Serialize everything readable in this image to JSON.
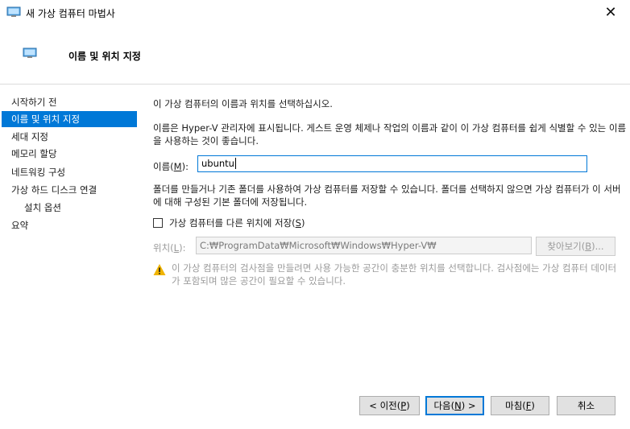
{
  "window": {
    "title": "새 가상 컴퓨터 마법사",
    "icon": "computer-monitor-icon",
    "close_glyph": "✕"
  },
  "header": {
    "title": "이름 및 위치 지정",
    "icon": "computer-monitor-icon"
  },
  "nav": {
    "items": [
      {
        "label": "시작하기 전",
        "selected": false
      },
      {
        "label": "이름 및 위치 지정",
        "selected": true
      },
      {
        "label": "세대 지정",
        "selected": false
      },
      {
        "label": "메모리 할당",
        "selected": false
      },
      {
        "label": "네트워킹 구성",
        "selected": false
      },
      {
        "label": "가상 하드 디스크 연결",
        "selected": false
      },
      {
        "label": "설치 옵션",
        "selected": false,
        "sub": true
      },
      {
        "label": "요약",
        "selected": false
      }
    ]
  },
  "content": {
    "intro": "이 가상 컴퓨터의 이름과 위치를 선택하십시오.",
    "description": "이름은 Hyper-V 관리자에 표시됩니다. 게스트 운영 체제나 작업의 이름과 같이 이 가상 컴퓨터를 쉽게 식별할 수 있는 이름을 사용하는 것이 좋습니다.",
    "name_label_pre": "이름(",
    "name_label_key": "M",
    "name_label_post": "):",
    "name_value": "ubuntu",
    "folder_note": "폴더를 만들거나 기존 폴더를 사용하여 가상 컴퓨터를 저장할 수 있습니다. 폴더를 선택하지 않으면 가상 컴퓨터가 이 서버에 대해 구성된 기본 폴더에 저장됩니다.",
    "checkbox_label_pre": "가상 컴퓨터를 다른 위치에 저장(",
    "checkbox_label_key": "S",
    "checkbox_label_post": ")",
    "checkbox_checked": false,
    "location_label_pre": "위치(",
    "location_label_key": "L",
    "location_label_post": "):",
    "location_value": "C:₩ProgramData₩Microsoft₩Windows₩Hyper-V₩",
    "browse_label_pre": "찾아보기(",
    "browse_label_key": "B",
    "browse_label_post": ")...",
    "warning": "이 가상 컴퓨터의 검사점을 만들려면 사용 가능한 공간이 충분한 위치를 선택합니다. 검사점에는 가상 컴퓨터 데이터가 포함되며 많은 공간이 필요할 수 있습니다."
  },
  "buttons": {
    "prev": {
      "pre": "< 이전(",
      "key": "P",
      "post": ")"
    },
    "next": {
      "pre": "다음(",
      "key": "N",
      "post": ") >"
    },
    "finish": {
      "pre": "마침(",
      "key": "F",
      "post": ")"
    },
    "cancel": {
      "label": "취소"
    }
  },
  "colors": {
    "accent": "#0078d7",
    "warning": "#f0b400"
  }
}
